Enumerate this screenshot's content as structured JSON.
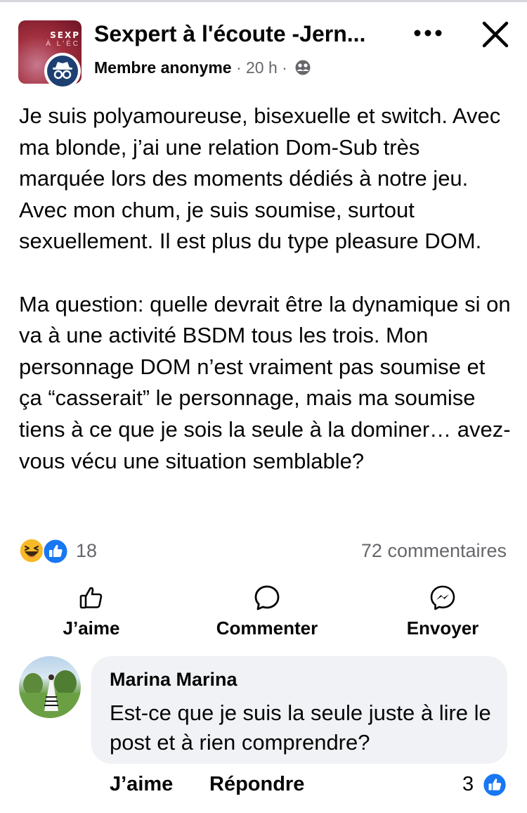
{
  "header": {
    "group_name": "Sexpert à l'écoute -Jern...",
    "author": "Membre anonyme",
    "separator": "·",
    "time": "20 h",
    "avatar_brand_top": "SEXP",
    "avatar_brand_bottom": "À L'ÉC",
    "icons": [
      "more-options-icon",
      "close-icon",
      "privacy-group-icon",
      "anonymous-member-icon"
    ]
  },
  "post": {
    "paragraph_1": "Je suis polyamoureuse, bisexuelle et switch. Avec ma blonde, j’ai une relation Dom-Sub très marquée lors des moments dédiés à notre jeu. Avec mon chum, je suis soumise, surtout sexuellement. Il est plus du type pleasure DOM.",
    "paragraph_2": "Ma question: quelle devrait être la dynamique si on va à une activité BSDM tous les trois. Mon personnage DOM n’est vraiment pas soumise et ça “casserait” le personnage, mais ma soumise tiens à ce que je sois la seule à la dominer… avez-vous vécu une situation semblable?"
  },
  "stats": {
    "reactions_count": "18",
    "reaction_types": [
      "haha-reaction-icon",
      "like-reaction-icon"
    ],
    "comments": "72 commentaires"
  },
  "actions": {
    "like": "J’aime",
    "comment": "Commenter",
    "send": "Envoyer"
  },
  "comment": {
    "author": "Marina Marina",
    "text": "Est-ce que je suis la seule juste à lire le post et à rien comprendre?",
    "like": "J’aime",
    "reply": "Répondre",
    "reactions_count": "3"
  },
  "colors": {
    "facebook_blue": "#1877f2",
    "secondary_text": "#65676b",
    "bubble_bg": "#f0f2f5",
    "haha_yellow": "#f7b928"
  }
}
